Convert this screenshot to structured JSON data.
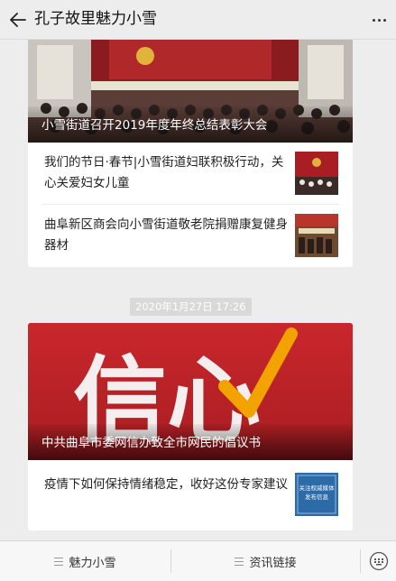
{
  "header": {
    "title": "孔子故里魅力小雪"
  },
  "feed": {
    "group1": {
      "lead_title": "小雪街道召开2019年度年终总结表彰大会",
      "items": [
        {
          "title": "我们的节日·春节|小雪街道妇联积极行动，关心关爱妇女儿童"
        },
        {
          "title": "曲阜新区商会向小雪街道敬老院捐赠康复健身器材"
        }
      ]
    },
    "timestamp": "2020年1月27日 17:26",
    "group2": {
      "lead_title": "中共曲阜市委网信办致全市网民的倡议书",
      "lead_image_text": "信心",
      "items": [
        {
          "title": "疫情下如何保持情绪稳定，收好这份专家建议",
          "thumb_text": [
            "关注权威媒体",
            "发布信息"
          ]
        }
      ]
    }
  },
  "bottom_menu": {
    "items": [
      {
        "label": "魅力小雪"
      },
      {
        "label": "资讯链接"
      }
    ]
  },
  "colors": {
    "hero2_red": "#c8262b",
    "accent_orange": "#f2a300"
  }
}
